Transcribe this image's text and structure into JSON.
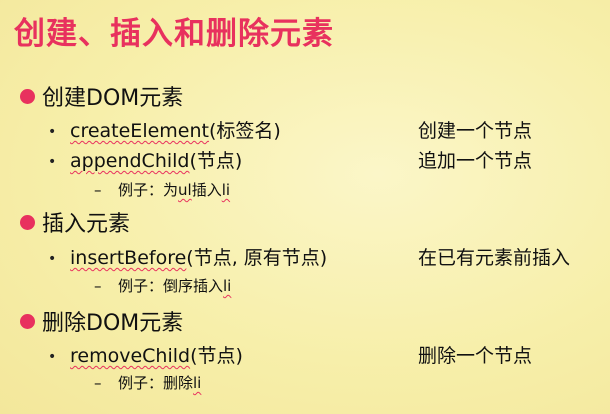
{
  "slide": {
    "title": "创建、插入和删除元素",
    "sections": [
      {
        "heading": "创建DOM元素",
        "items": [
          {
            "method": "createElement",
            "args": "(标签名)",
            "description": "创建一个节点"
          },
          {
            "method": "appendChild",
            "args": "(节点)",
            "description": "追加一个节点"
          }
        ],
        "example": {
          "prefix": "–",
          "text": "例子：为",
          "code1": "ul",
          "middle": "插入",
          "code2": "li"
        }
      },
      {
        "heading": "插入元素",
        "items": [
          {
            "method": "insertBefore",
            "args": "(节点, 原有节点)",
            "description": "在已有元素前插入"
          }
        ],
        "example": {
          "prefix": "–",
          "text": "例子：倒序插入",
          "code1": "li"
        }
      },
      {
        "heading": "删除DOM元素",
        "items": [
          {
            "method": "removeChild",
            "args": "(节点)",
            "description": "删除一个节点"
          }
        ],
        "example": {
          "prefix": "–",
          "text": "例子：删除",
          "code1": "li"
        }
      }
    ]
  }
}
